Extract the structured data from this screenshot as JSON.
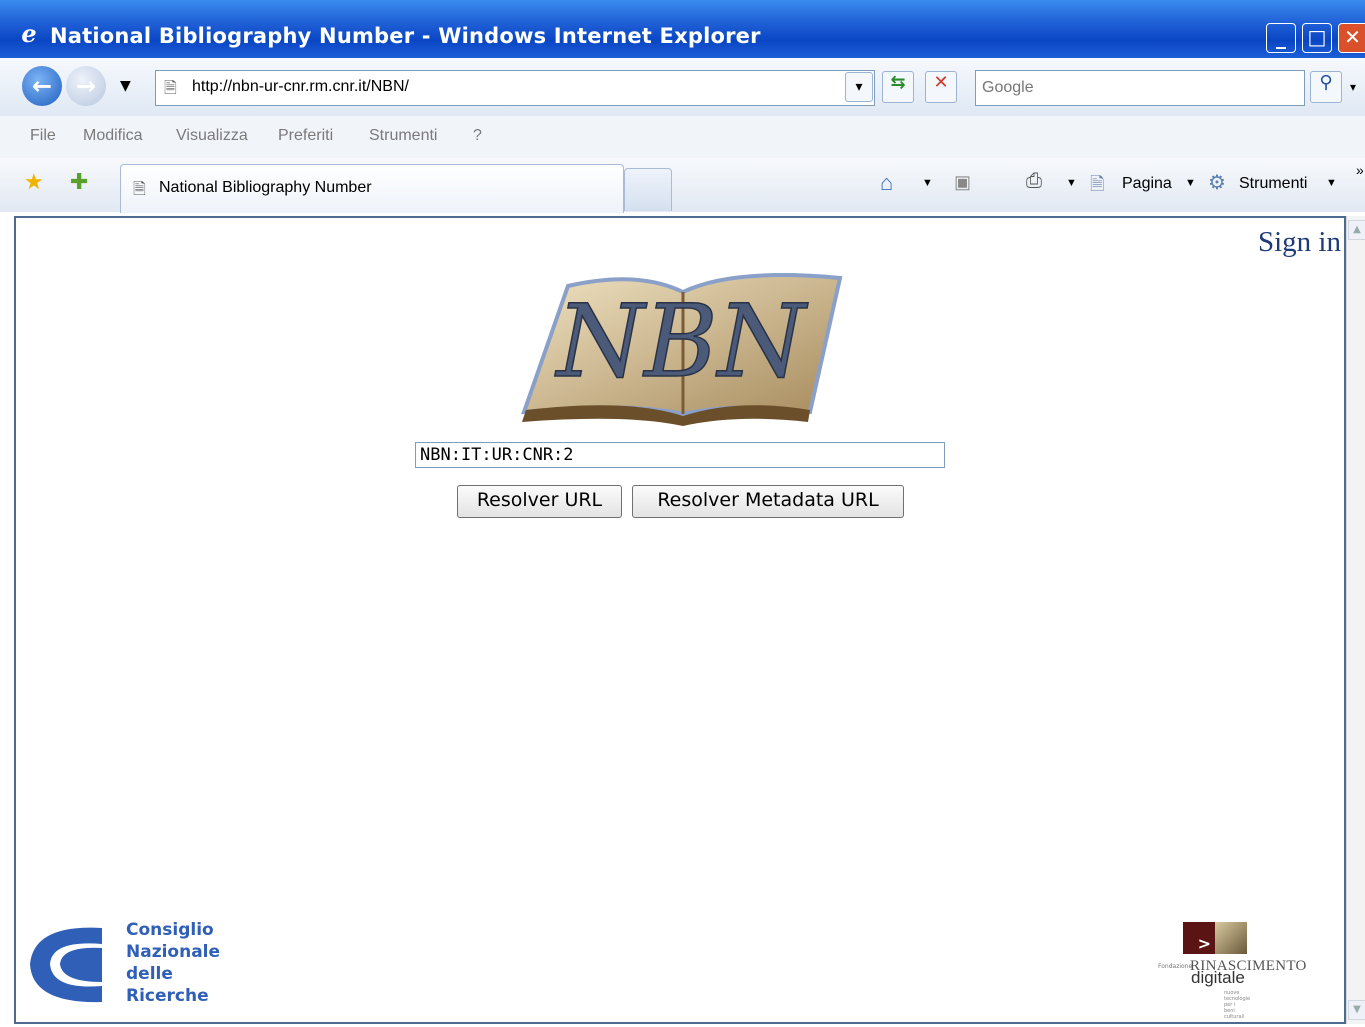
{
  "window": {
    "title": "National Bibliography Number - Windows Internet Explorer"
  },
  "address_bar": {
    "url": "http://nbn-ur-cnr.rm.cnr.it/NBN/"
  },
  "search": {
    "placeholder": "Google"
  },
  "menu": [
    "File",
    "Modifica",
    "Visualizza",
    "Preferiti",
    "Strumenti",
    "?"
  ],
  "tabs": [
    {
      "label": "National Bibliography Number"
    }
  ],
  "command_bar": {
    "page_label": "Pagina",
    "tools_label": "Strumenti"
  },
  "page": {
    "sign_in": "Sign in",
    "logo_text": "NBN",
    "nbn_value": "NBN:IT:UR:CNR:2",
    "resolver_url_label": "Resolver URL",
    "resolver_metadata_label": "Resolver Metadata URL"
  },
  "footer": {
    "cnr_lines": [
      "Consiglio",
      "Nazionale",
      "delle",
      "Ricerche"
    ],
    "rinascimento": {
      "fondazione": "Fondazione",
      "name": "RINASCIMENTO",
      "digitale": "digitale",
      "tagline": "nuove tecnologie per i beni culturali"
    }
  },
  "colors": {
    "titlebar": "#1f5fd6",
    "signin": "#1f3b77",
    "cnr_blue": "#2f5fb6",
    "rinascimento_red": "#5a1414"
  }
}
